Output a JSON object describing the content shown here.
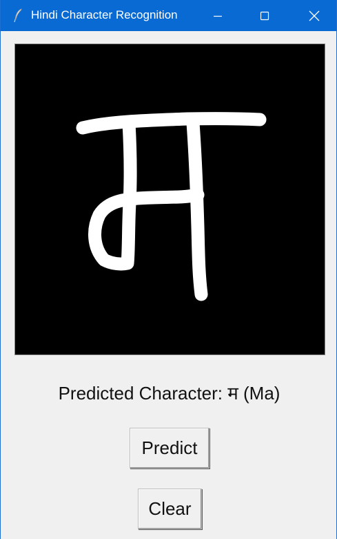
{
  "window": {
    "title": "Hindi Character Recognition",
    "icon": "feather-icon",
    "controls": [
      "minimize-icon",
      "maximize-icon",
      "close-icon"
    ]
  },
  "canvas": {
    "background": "#000000",
    "stroke_color": "#ffffff",
    "drawn_character": "म"
  },
  "prediction": {
    "text": "Predicted Character: म (Ma)"
  },
  "buttons": {
    "predict_label": "Predict",
    "clear_label": "Clear"
  },
  "colors": {
    "titlebar": "#0a6ad4",
    "window_bg": "#f0f0f0"
  }
}
